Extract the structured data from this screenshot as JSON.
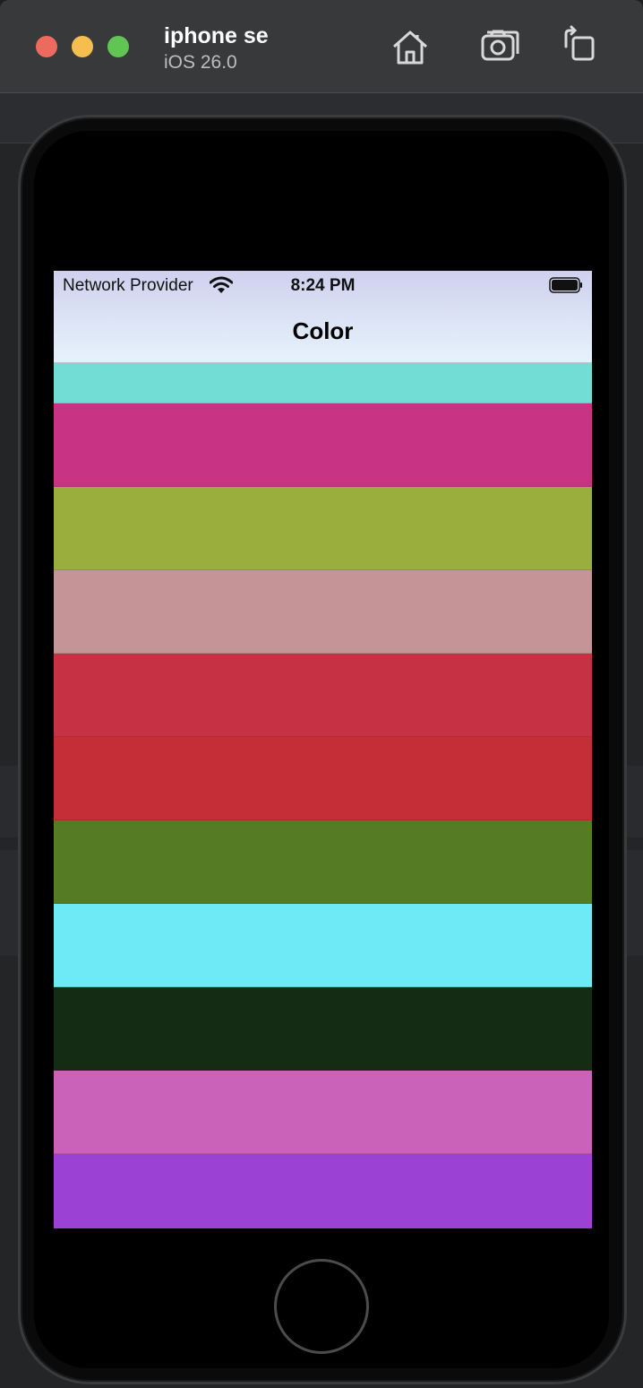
{
  "window": {
    "device_name": "iphone se",
    "os_version": "iOS 26.0",
    "toolbar": [
      {
        "name": "home-icon"
      },
      {
        "name": "screenshot-icon"
      },
      {
        "name": "rotate-icon"
      }
    ]
  },
  "status_bar": {
    "carrier": "Network Provider",
    "time": "8:24 PM"
  },
  "nav": {
    "title": "Color"
  },
  "color_rows": [
    {
      "color": "#72ddd4",
      "height": 45
    },
    {
      "color": "#c93384",
      "height": 93
    },
    {
      "color": "#9aae3e",
      "height": 93
    },
    {
      "color": "#c49497",
      "height": 93
    },
    {
      "color": "#c63243",
      "height": 93
    },
    {
      "color": "#c52e36",
      "height": 93
    },
    {
      "color": "#557c25",
      "height": 93
    },
    {
      "color": "#6deaf6",
      "height": 93
    },
    {
      "color": "#152c14",
      "height": 93
    },
    {
      "color": "#cb62b9",
      "height": 93
    },
    {
      "color": "#9b42d5",
      "height": 84
    }
  ]
}
